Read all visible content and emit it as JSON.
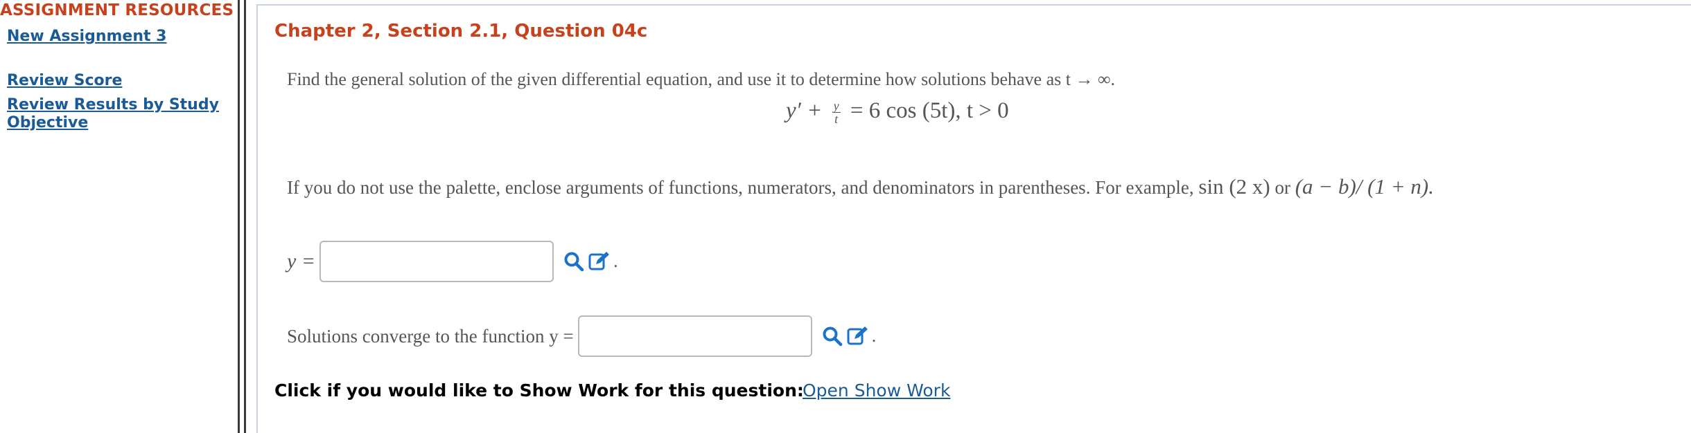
{
  "sidebar": {
    "title": "ASSIGNMENT RESOURCES",
    "links": [
      "New Assignment 3",
      "Review Score",
      "Review Results by Study Objective"
    ]
  },
  "question": {
    "title": "Chapter 2, Section 2.1, Question 04c",
    "stem": "Find the general solution of the given differential equation, and use it to determine how solutions behave as t → ∞.",
    "equation": {
      "lhs_left": "y′ +",
      "frac_num": "y",
      "frac_den": "t",
      "rhs": "= 6 cos (5t), t > 0"
    },
    "instructions_text": "If you do not use the palette, enclose arguments of functions, numerators, and denominators in parentheses. For example,",
    "example_1": "sin (2 x)",
    "example_or": "or",
    "example_2": "(a − b)/ (1 + n)."
  },
  "answers": [
    {
      "label": "y =",
      "value": "",
      "placeholder": ""
    },
    {
      "label": "Solutions converge to the function y =",
      "value": "",
      "placeholder": ""
    }
  ],
  "icons": {
    "search": "magnifier-icon",
    "edit": "edit-pencil-icon",
    "color": "#1a73c8"
  },
  "show_work": {
    "prompt": "Click if you would like to Show Work for this question:",
    "link": "Open Show Work"
  },
  "colors": {
    "accent": "#c8411d",
    "link": "#1a5a96",
    "icon": "#1a73c8"
  }
}
